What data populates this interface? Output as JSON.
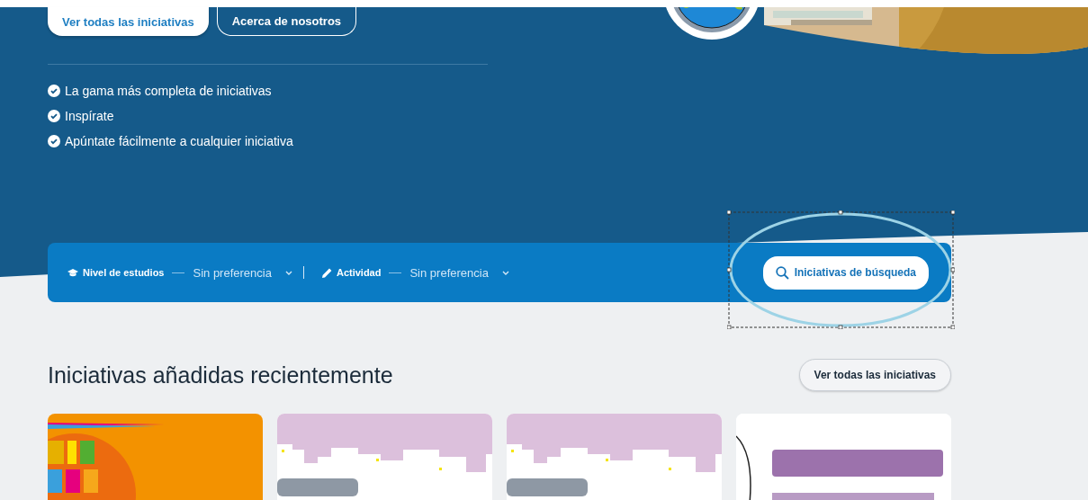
{
  "hero": {
    "buttons": [
      {
        "label": "Ver todas las iniciativas",
        "kind": "primary"
      },
      {
        "label": "Acerca de nosotros",
        "kind": "outline"
      }
    ],
    "features": [
      "La gama más completa de iniciativas",
      "Inspírate",
      "Apúntate fácilmente a cualquier iniciativa"
    ]
  },
  "filters": {
    "fields": [
      {
        "kind": "education",
        "label": "Nivel de estudios",
        "value": "Sin preferencia"
      },
      {
        "kind": "activity",
        "label": "Actividad",
        "value": "Sin preferencia"
      }
    ],
    "search_button": "Iniciativas de búsqueda"
  },
  "recent": {
    "title": "Iniciativas añadidas recientemente",
    "view_all": "Ver todas las iniciativas"
  }
}
